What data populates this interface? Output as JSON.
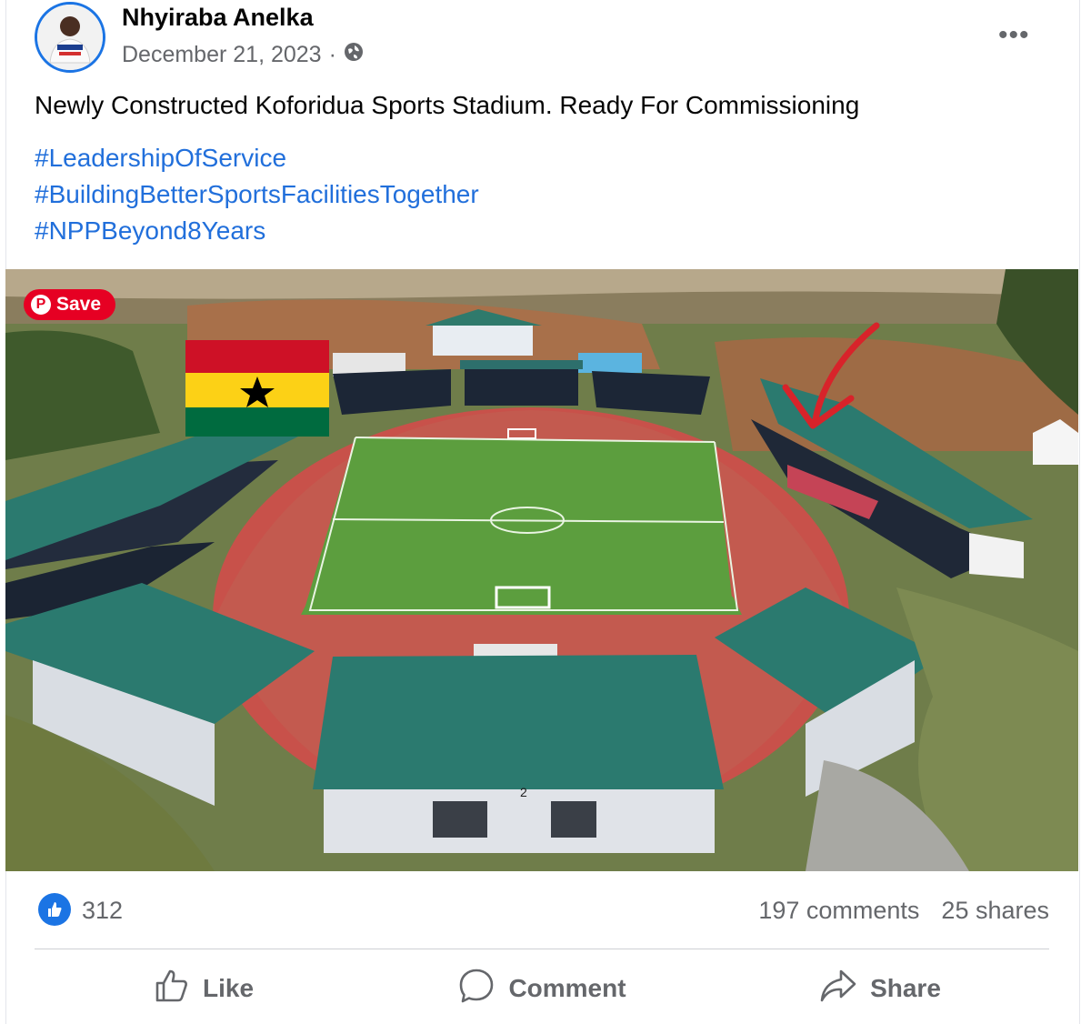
{
  "post": {
    "author": "Nhyiraba Anelka",
    "date": "December 21, 2023",
    "separator": "·",
    "privacy_icon": "globe-icon",
    "more_label": "•••",
    "text": "Newly Constructed Koforidua Sports Stadium. Ready For Commissioning",
    "hashtags": [
      "#LeadershipOfService",
      "#BuildingBetterSportsFacilitiesTogether",
      "#NPPBeyond8Years"
    ]
  },
  "image": {
    "save_label": "Save",
    "flag_colors": [
      "#ce1126",
      "#fcd116",
      "#006b3f"
    ],
    "arrow_color": "#d8232a",
    "stand_number": "2"
  },
  "stats": {
    "likes": "312",
    "comments": "197 comments",
    "shares": "25 shares"
  },
  "actions": {
    "like": "Like",
    "comment": "Comment",
    "share": "Share"
  },
  "colors": {
    "link": "#216fdb",
    "like_blue": "#1b74e4",
    "muted": "#65676b",
    "pinterest": "#e60023"
  }
}
